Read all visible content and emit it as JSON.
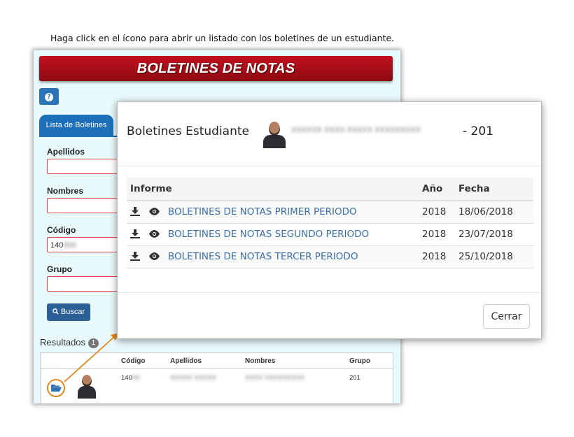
{
  "instruction": "Haga click en el ícono para abrir un listado con los boletines de un estudiante.",
  "app": {
    "banner_title": "BOLETINES DE NOTAS",
    "help_icon": "?",
    "tab_label": "Lista de Boletines",
    "fields": {
      "apellidos_label": "Apellidos",
      "nombres_label": "Nombres",
      "codigo_label": "Código",
      "codigo_value": "140",
      "grupo_label": "Grupo"
    },
    "search_button": "Buscar",
    "results_label": "Resultados",
    "results_count": "1",
    "results_table": {
      "headers": {
        "codigo": "Código",
        "apellidos": "Apellidos",
        "nombres": "Nombres",
        "grupo": "Grupo"
      },
      "row": {
        "codigo": "140",
        "grupo": "201"
      }
    }
  },
  "modal": {
    "title": "Boletines Estudiante",
    "student_suffix": "- 201",
    "headers": {
      "informe": "Informe",
      "anio": "Año",
      "fecha": "Fecha"
    },
    "rows": [
      {
        "informe": "BOLETINES DE NOTAS PRIMER PERIODO",
        "anio": "2018",
        "fecha": "18/06/2018"
      },
      {
        "informe": "BOLETINES DE NOTAS SEGUNDO PERIODO",
        "anio": "2018",
        "fecha": "23/07/2018"
      },
      {
        "informe": "BOLETINES DE NOTAS TERCER PERIODO",
        "anio": "2018",
        "fecha": "25/10/2018"
      }
    ],
    "close_button": "Cerrar"
  },
  "colors": {
    "banner": "#b0101c",
    "accent": "#2b73b7",
    "link": "#3a6fa8",
    "arrow": "#e08a1e"
  }
}
